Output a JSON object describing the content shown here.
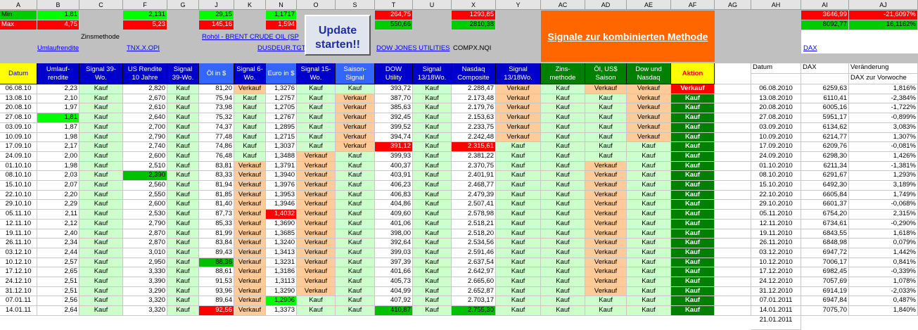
{
  "column_letters": [
    "A",
    "B",
    "C",
    "F",
    "G",
    "J",
    "K",
    "N",
    "O",
    "S",
    "T",
    "U",
    "X",
    "Y",
    "AC",
    "AD",
    "AE",
    "AF",
    "AG",
    "AH",
    "AI",
    "AJ"
  ],
  "top": {
    "min_label": "Min",
    "max_label": "Max",
    "min_B": "1,81",
    "max_B": "4,75",
    "min_F": "2,131",
    "max_F": "5,23",
    "min_J": "29,15",
    "max_J": "145,16",
    "min_N": "1,1717",
    "max_N": "1,594",
    "min_T": "264,75",
    "max_T": "550,66",
    "min_X": "1293,85",
    "max_X": "2810,38",
    "min_AI": "3646,99",
    "min_AJ": "-21,6097%",
    "max_AI": "8092,77",
    "max_AJ": "16,1162%",
    "zinsmethode": "Zinsmethode",
    "oil_link": "Rohöl - BRENT CRUDE OIL (SP",
    "umlauf_link": "Umlaufrendite",
    "tnx_link": "TNX.X.OPI",
    "usdeur_link": "DUSDEUR.TGT",
    "dow_link": "DOW JONES UTILITIES",
    "compx": "COMPX.NQI",
    "dax_link": "DAX",
    "update_button": "Update starten!!",
    "banner": "Signale zur kombinierten Methode",
    "dax_title": "DAX zur Vorwoche",
    "last_date": "21.01.2011"
  },
  "headers": {
    "datum": "Datum",
    "umlauf": "Umlauf-rendite",
    "sig39a": "Signal 39-Wo.",
    "usrendite": "US Rendite 10 Jahre",
    "sig39b": "Signal 39-Wo.",
    "oel": "Öl in $",
    "sig6": "Signal 6-Wo.",
    "euro": "Euro in $",
    "sig15": "Signal 15-Wo.",
    "saison": "Saison-Signal",
    "dow": "DOW Utility",
    "sig1318a": "Signal 13/18Wo.",
    "nasdaq": "Nasdaq Composite",
    "sig1318b": "Signal 13/18Wo.",
    "zins": "Zins-methode",
    "oelsaison": "Öl, US$ Saison",
    "downdq": "Dow und Nasdaq",
    "aktion": "Aktion",
    "datum2": "Datum",
    "dax": "DAX",
    "veraenderung": "Veränderung"
  },
  "rows": [
    [
      "06.08.10",
      "2,23",
      "Kauf",
      "2,820",
      "Kauf",
      "81,20",
      "Verkauf",
      "1,3276",
      "Kauf",
      "Kauf",
      "393,72",
      "Kauf",
      "2.288,47",
      "Verkauf",
      "Kauf",
      "Verkauf",
      "Verkauf",
      "Verkauf",
      "06.08.2010",
      "6259,63",
      "1,816%"
    ],
    [
      "13.08.10",
      "2,10",
      "Kauf",
      "2,670",
      "Kauf",
      "75,94",
      "Kauf",
      "1,2757",
      "Kauf",
      "Verkauf",
      "387,70",
      "Kauf",
      "2.173,48",
      "Verkauf",
      "Kauf",
      "Kauf",
      "Verkauf",
      "Kauf",
      "13.08.2010",
      "6110,41",
      "-2,384%"
    ],
    [
      "20.08.10",
      "1,97",
      "Kauf",
      "2,610",
      "Kauf",
      "73,98",
      "Kauf",
      "1,2705",
      "Kauf",
      "Verkauf",
      "385,63",
      "Kauf",
      "2.179,76",
      "Verkauf",
      "Kauf",
      "Kauf",
      "Verkauf",
      "Kauf",
      "20.08.2010",
      "6005,16",
      "-1,722%"
    ],
    [
      "27.08.10",
      "1,81",
      "Kauf",
      "2,640",
      "Kauf",
      "75,32",
      "Kauf",
      "1,2767",
      "Kauf",
      "Verkauf",
      "392,45",
      "Kauf",
      "2.153,63",
      "Verkauf",
      "Kauf",
      "Kauf",
      "Verkauf",
      "Kauf",
      "27.08.2010",
      "5951,17",
      "-0,899%"
    ],
    [
      "03.09.10",
      "1,87",
      "Kauf",
      "2,700",
      "Kauf",
      "74,37",
      "Kauf",
      "1,2895",
      "Kauf",
      "Verkauf",
      "399,52",
      "Kauf",
      "2.233,75",
      "Verkauf",
      "Kauf",
      "Kauf",
      "Verkauf",
      "Kauf",
      "03.09.2010",
      "6134,62",
      "3,083%"
    ],
    [
      "10.09.10",
      "1,98",
      "Kauf",
      "2,790",
      "Kauf",
      "77,48",
      "Kauf",
      "1,2715",
      "Kauf",
      "Verkauf",
      "394,74",
      "Kauf",
      "2.242,48",
      "Verkauf",
      "Kauf",
      "Kauf",
      "Verkauf",
      "Kauf",
      "10.09.2010",
      "6214,77",
      "1,307%"
    ],
    [
      "17.09.10",
      "2,17",
      "Kauf",
      "2,740",
      "Kauf",
      "74,86",
      "Kauf",
      "1,3037",
      "Kauf",
      "Verkauf",
      "391,12",
      "Kauf",
      "2.315,61",
      "Kauf",
      "Kauf",
      "Kauf",
      "Kauf",
      "Kauf",
      "17.09.2010",
      "6209,76",
      "-0,081%"
    ],
    [
      "24.09.10",
      "2,00",
      "Kauf",
      "2,600",
      "Kauf",
      "76,48",
      "Kauf",
      "1,3488",
      "Verkauf",
      "Kauf",
      "399,93",
      "Kauf",
      "2.381,22",
      "Kauf",
      "Kauf",
      "Kauf",
      "Kauf",
      "Kauf",
      "24.09.2010",
      "6298,30",
      "1,426%"
    ],
    [
      "01.10.10",
      "1,98",
      "Kauf",
      "2,510",
      "Kauf",
      "83,81",
      "Verkauf",
      "1,3791",
      "Verkauf",
      "Kauf",
      "400,37",
      "Kauf",
      "2.370,75",
      "Kauf",
      "Kauf",
      "Verkauf",
      "Kauf",
      "Kauf",
      "01.10.2010",
      "6211,34",
      "-1,381%"
    ],
    [
      "08.10.10",
      "2,03",
      "Kauf",
      "2,390",
      "Kauf",
      "83,33",
      "Verkauf",
      "1,3940",
      "Verkauf",
      "Kauf",
      "403,91",
      "Kauf",
      "2.401,91",
      "Kauf",
      "Kauf",
      "Verkauf",
      "Kauf",
      "Kauf",
      "08.10.2010",
      "6291,67",
      "1,293%"
    ],
    [
      "15.10.10",
      "2,07",
      "Kauf",
      "2,560",
      "Kauf",
      "81,94",
      "Verkauf",
      "1,3976",
      "Verkauf",
      "Kauf",
      "406,23",
      "Kauf",
      "2.468,77",
      "Kauf",
      "Kauf",
      "Verkauf",
      "Kauf",
      "Kauf",
      "15.10.2010",
      "6492,30",
      "3,189%"
    ],
    [
      "22.10.10",
      "2,20",
      "Kauf",
      "2,550",
      "Kauf",
      "81,85",
      "Verkauf",
      "1,3953",
      "Verkauf",
      "Kauf",
      "406,83",
      "Kauf",
      "2.479,39",
      "Kauf",
      "Kauf",
      "Verkauf",
      "Kauf",
      "Kauf",
      "22.10.2010",
      "6605,84",
      "1,749%"
    ],
    [
      "29.10.10",
      "2,29",
      "Kauf",
      "2,600",
      "Kauf",
      "81,40",
      "Verkauf",
      "1,3946",
      "Verkauf",
      "Kauf",
      "404,86",
      "Kauf",
      "2.507,41",
      "Kauf",
      "Kauf",
      "Verkauf",
      "Kauf",
      "Kauf",
      "29.10.2010",
      "6601,37",
      "-0,068%"
    ],
    [
      "05.11.10",
      "2,11",
      "Kauf",
      "2,530",
      "Kauf",
      "87,73",
      "Verkauf",
      "1,4032",
      "Verkauf",
      "Kauf",
      "409,60",
      "Kauf",
      "2.578,98",
      "Kauf",
      "Kauf",
      "Verkauf",
      "Kauf",
      "Kauf",
      "05.11.2010",
      "6754,20",
      "2,315%"
    ],
    [
      "12.11.10",
      "2,12",
      "Kauf",
      "2,790",
      "Kauf",
      "85,33",
      "Verkauf",
      "1,3690",
      "Verkauf",
      "Kauf",
      "401,06",
      "Kauf",
      "2.518,21",
      "Kauf",
      "Kauf",
      "Verkauf",
      "Kauf",
      "Kauf",
      "12.11.2010",
      "6734,61",
      "-0,290%"
    ],
    [
      "19.11.10",
      "2,40",
      "Kauf",
      "2,870",
      "Kauf",
      "81,99",
      "Verkauf",
      "1,3685",
      "Verkauf",
      "Kauf",
      "398,00",
      "Kauf",
      "2.518,20",
      "Kauf",
      "Kauf",
      "Verkauf",
      "Kauf",
      "Kauf",
      "19.11.2010",
      "6843,55",
      "1,618%"
    ],
    [
      "26.11.10",
      "2,34",
      "Kauf",
      "2,870",
      "Kauf",
      "83,84",
      "Verkauf",
      "1,3240",
      "Verkauf",
      "Kauf",
      "392,64",
      "Kauf",
      "2.534,56",
      "Kauf",
      "Kauf",
      "Verkauf",
      "Kauf",
      "Kauf",
      "26.11.2010",
      "6848,98",
      "0,079%"
    ],
    [
      "03.12.10",
      "2,44",
      "Kauf",
      "3,010",
      "Kauf",
      "89,43",
      "Verkauf",
      "1,3413",
      "Verkauf",
      "Kauf",
      "399,03",
      "Kauf",
      "2.591,46",
      "Kauf",
      "Kauf",
      "Verkauf",
      "Kauf",
      "Kauf",
      "03.12.2010",
      "6947,72",
      "1,442%"
    ],
    [
      "10.12.10",
      "2,57",
      "Kauf",
      "2,950",
      "Kauf",
      "88,36",
      "Verkauf",
      "1,3231",
      "Verkauf",
      "Kauf",
      "397,39",
      "Kauf",
      "2.637,54",
      "Kauf",
      "Kauf",
      "Verkauf",
      "Kauf",
      "Kauf",
      "10.12.2010",
      "7006,17",
      "0,841%"
    ],
    [
      "17.12.10",
      "2,65",
      "Kauf",
      "3,330",
      "Kauf",
      "88,61",
      "Verkauf",
      "1,3186",
      "Verkauf",
      "Kauf",
      "401,66",
      "Kauf",
      "2.642,97",
      "Kauf",
      "Kauf",
      "Verkauf",
      "Kauf",
      "Kauf",
      "17.12.2010",
      "6982,45",
      "-0,339%"
    ],
    [
      "24.12.10",
      "2,51",
      "Kauf",
      "3,390",
      "Kauf",
      "91,53",
      "Verkauf",
      "1,3113",
      "Verkauf",
      "Kauf",
      "405,73",
      "Kauf",
      "2.665,60",
      "Kauf",
      "Kauf",
      "Verkauf",
      "Kauf",
      "Kauf",
      "24.12.2010",
      "7057,69",
      "1,078%"
    ],
    [
      "31.12.10",
      "2,51",
      "Kauf",
      "3,290",
      "Kauf",
      "93,96",
      "Verkauf",
      "1,3290",
      "Verkauf",
      "Kauf",
      "404,99",
      "Kauf",
      "2.652,87",
      "Kauf",
      "Kauf",
      "Verkauf",
      "Kauf",
      "Kauf",
      "31.12.2010",
      "6914,19",
      "-2,033%"
    ],
    [
      "07.01.11",
      "2,56",
      "Kauf",
      "3,320",
      "Kauf",
      "89,64",
      "Verkauf",
      "1,2906",
      "Kauf",
      "Kauf",
      "407,92",
      "Kauf",
      "2.703,17",
      "Kauf",
      "Kauf",
      "Kauf",
      "Kauf",
      "Kauf",
      "07.01.2011",
      "6947,84",
      "0,487%"
    ],
    [
      "14.01.11",
      "2,64",
      "Kauf",
      "3,320",
      "Kauf",
      "92,56",
      "Verkauf",
      "1,3373",
      "Kauf",
      "Kauf",
      "410,87",
      "Kauf",
      "2.755,30",
      "Kauf",
      "Kauf",
      "Kauf",
      "Kauf",
      "Kauf",
      "14.01.2011",
      "7075,70",
      "1,840%"
    ]
  ],
  "highlights": [
    {
      "row": 3,
      "col": 1,
      "style": "hl-green2"
    },
    {
      "row": 9,
      "col": 3,
      "style": "hl-green"
    },
    {
      "row": 6,
      "col": 10,
      "style": "hl-red"
    },
    {
      "row": 6,
      "col": 12,
      "style": "hl-red"
    },
    {
      "row": 13,
      "col": 7,
      "style": "hl-red"
    },
    {
      "row": 18,
      "col": 5,
      "style": "hl-green"
    },
    {
      "row": 22,
      "col": 7,
      "style": "hl-green2"
    },
    {
      "row": 23,
      "col": 5,
      "style": "hl-red"
    },
    {
      "row": 23,
      "col": 10,
      "style": "hl-green"
    },
    {
      "row": 23,
      "col": 12,
      "style": "hl-green"
    }
  ],
  "colors": {
    "blue_header": "#0000cc",
    "green_header": "#008000",
    "yellow_header": "#ffff00",
    "orange_banner": "#ff6600",
    "kauf": "#ccffcc",
    "verkauf": "#ffcc99"
  }
}
